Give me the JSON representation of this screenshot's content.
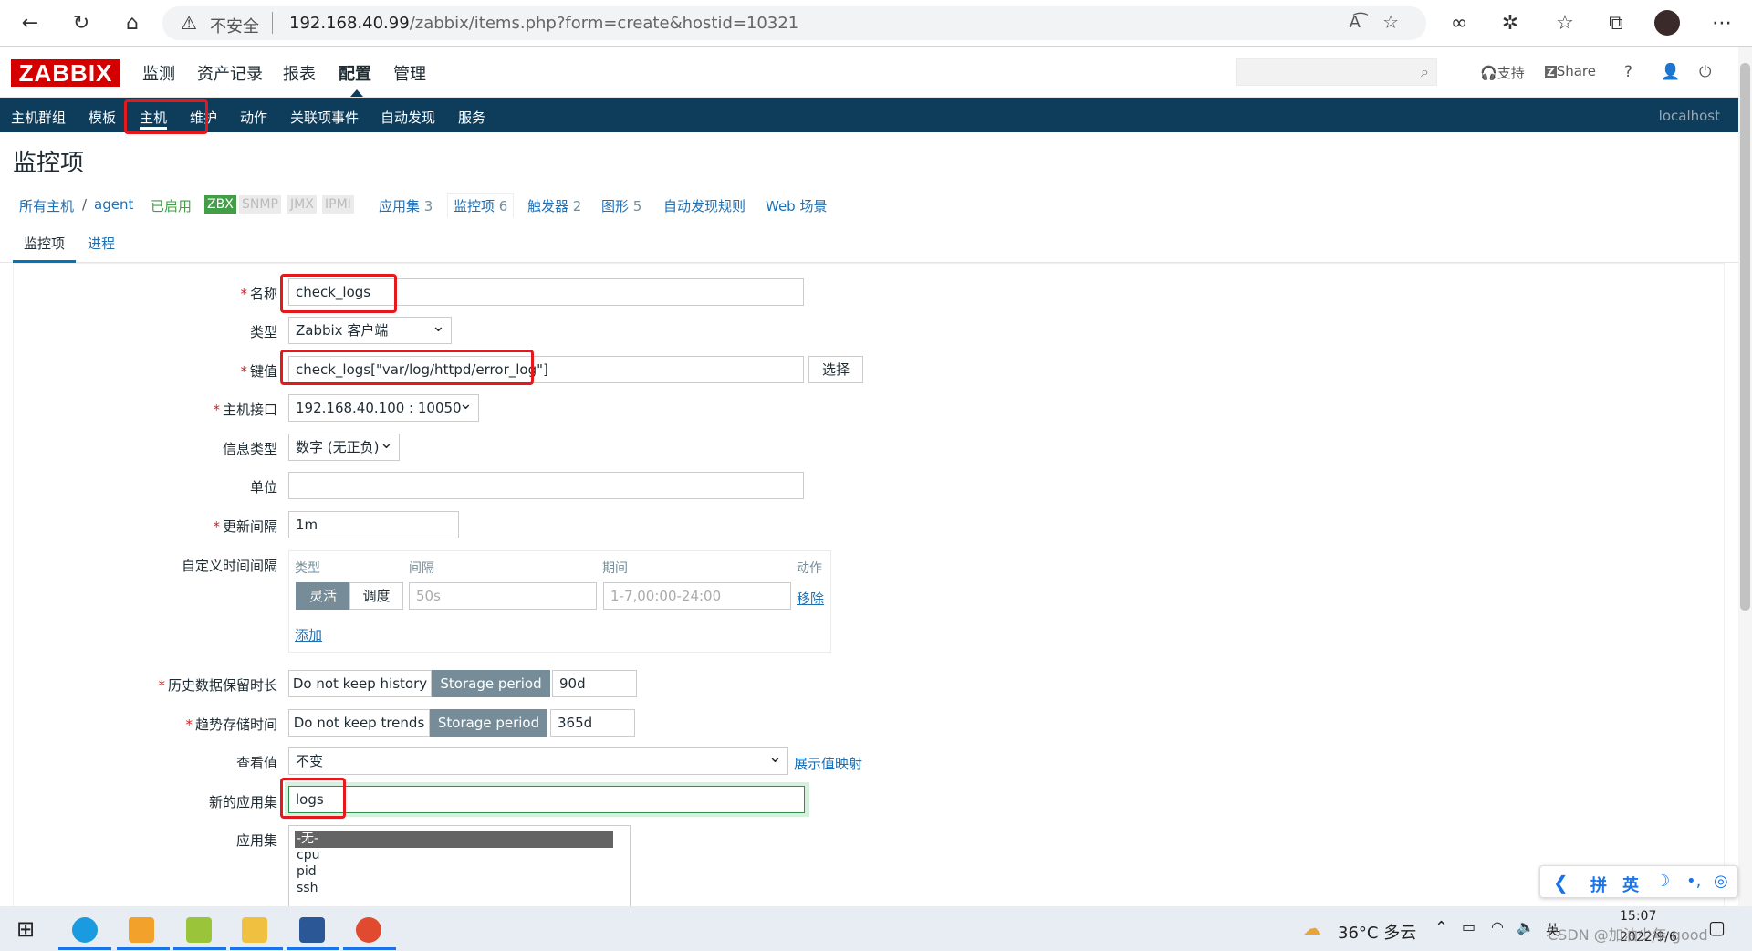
{
  "browser": {
    "insecure_label": "不安全",
    "url_host": "192.168.40.99",
    "url_path": "/zabbix/items.php?form=create&hostid=10321"
  },
  "header": {
    "logo": "ZABBIX",
    "menu": [
      "监测",
      "资产记录",
      "报表",
      "配置",
      "管理"
    ],
    "support": "支持",
    "share": "Share",
    "help": "?"
  },
  "subnav": {
    "items": [
      "主机群组",
      "模板",
      "主机",
      "维护",
      "动作",
      "关联项事件",
      "自动发现",
      "服务"
    ],
    "host": "localhost"
  },
  "page": {
    "title": "监控项",
    "breadcrumb": {
      "all_hosts": "所有主机",
      "sep": "/",
      "host": "agent",
      "enabled": "已启用",
      "zbx": "ZBX",
      "snmp": "SNMP",
      "jmx": "JMX",
      "ipmi": "IPMI",
      "apps": "应用集",
      "apps_count": "3",
      "items": "监控项",
      "items_count": "6",
      "triggers": "触发器",
      "triggers_count": "2",
      "graphs": "图形",
      "graphs_count": "5",
      "discovery": "自动发现规则",
      "web": "Web 场景"
    },
    "tabs": [
      "监控项",
      "进程"
    ]
  },
  "form": {
    "name_label": "名称",
    "name_value": "check_logs",
    "type_label": "类型",
    "type_value": "Zabbix 客户端",
    "key_label": "键值",
    "key_value": "check_logs[\"var/log/httpd/error_log\"]",
    "key_select": "选择",
    "iface_label": "主机接口",
    "iface_value": "192.168.40.100 : 10050",
    "info_label": "信息类型",
    "info_value": "数字 (无正负)",
    "unit_label": "单位",
    "unit_value": "",
    "interval_label": "更新间隔",
    "interval_value": "1m",
    "custom_label": "自定义时间间隔",
    "custom": {
      "col_type": "类型",
      "col_interval": "间隔",
      "col_period": "期间",
      "col_action": "动作",
      "flexible": "灵活",
      "scheduling": "调度",
      "interval_ph": "50s",
      "period_ph": "1-7,00:00-24:00",
      "remove": "移除",
      "add": "添加"
    },
    "history_label": "历史数据保留时长",
    "history_off": "Do not keep history",
    "history_on": "Storage period",
    "history_value": "90d",
    "trends_label": "趋势存储时间",
    "trends_off": "Do not keep trends",
    "trends_on": "Storage period",
    "trends_value": "365d",
    "valuemap_label": "查看值",
    "valuemap_value": "不变",
    "valuemap_link": "展示值映射",
    "newapp_label": "新的应用集",
    "newapp_value": "logs",
    "apps_label": "应用集",
    "apps": [
      "-无-",
      "cpu",
      "pid",
      "ssh"
    ]
  },
  "taskbar": {
    "weather": "36°C 多云",
    "time": "15:07",
    "date": "2022/9/6",
    "watermark": "CSDN @加油少年 good",
    "ime": [
      "拼",
      "英"
    ]
  }
}
